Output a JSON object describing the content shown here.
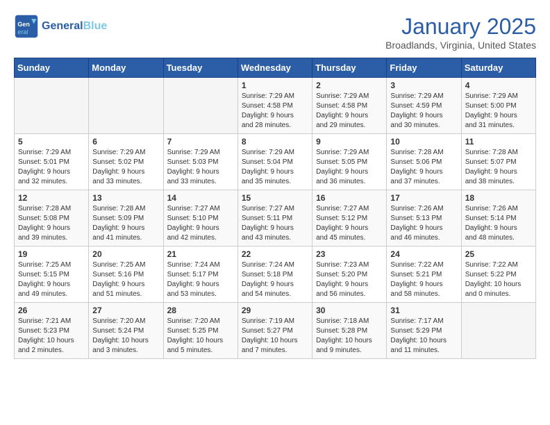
{
  "header": {
    "logo_general": "General",
    "logo_blue": "Blue",
    "month": "January 2025",
    "location": "Broadlands, Virginia, United States"
  },
  "days_of_week": [
    "Sunday",
    "Monday",
    "Tuesday",
    "Wednesday",
    "Thursday",
    "Friday",
    "Saturday"
  ],
  "weeks": [
    [
      {
        "day": "",
        "info": ""
      },
      {
        "day": "",
        "info": ""
      },
      {
        "day": "",
        "info": ""
      },
      {
        "day": "1",
        "info": "Sunrise: 7:29 AM\nSunset: 4:58 PM\nDaylight: 9 hours\nand 28 minutes."
      },
      {
        "day": "2",
        "info": "Sunrise: 7:29 AM\nSunset: 4:58 PM\nDaylight: 9 hours\nand 29 minutes."
      },
      {
        "day": "3",
        "info": "Sunrise: 7:29 AM\nSunset: 4:59 PM\nDaylight: 9 hours\nand 30 minutes."
      },
      {
        "day": "4",
        "info": "Sunrise: 7:29 AM\nSunset: 5:00 PM\nDaylight: 9 hours\nand 31 minutes."
      }
    ],
    [
      {
        "day": "5",
        "info": "Sunrise: 7:29 AM\nSunset: 5:01 PM\nDaylight: 9 hours\nand 32 minutes."
      },
      {
        "day": "6",
        "info": "Sunrise: 7:29 AM\nSunset: 5:02 PM\nDaylight: 9 hours\nand 33 minutes."
      },
      {
        "day": "7",
        "info": "Sunrise: 7:29 AM\nSunset: 5:03 PM\nDaylight: 9 hours\nand 33 minutes."
      },
      {
        "day": "8",
        "info": "Sunrise: 7:29 AM\nSunset: 5:04 PM\nDaylight: 9 hours\nand 35 minutes."
      },
      {
        "day": "9",
        "info": "Sunrise: 7:29 AM\nSunset: 5:05 PM\nDaylight: 9 hours\nand 36 minutes."
      },
      {
        "day": "10",
        "info": "Sunrise: 7:28 AM\nSunset: 5:06 PM\nDaylight: 9 hours\nand 37 minutes."
      },
      {
        "day": "11",
        "info": "Sunrise: 7:28 AM\nSunset: 5:07 PM\nDaylight: 9 hours\nand 38 minutes."
      }
    ],
    [
      {
        "day": "12",
        "info": "Sunrise: 7:28 AM\nSunset: 5:08 PM\nDaylight: 9 hours\nand 39 minutes."
      },
      {
        "day": "13",
        "info": "Sunrise: 7:28 AM\nSunset: 5:09 PM\nDaylight: 9 hours\nand 41 minutes."
      },
      {
        "day": "14",
        "info": "Sunrise: 7:27 AM\nSunset: 5:10 PM\nDaylight: 9 hours\nand 42 minutes."
      },
      {
        "day": "15",
        "info": "Sunrise: 7:27 AM\nSunset: 5:11 PM\nDaylight: 9 hours\nand 43 minutes."
      },
      {
        "day": "16",
        "info": "Sunrise: 7:27 AM\nSunset: 5:12 PM\nDaylight: 9 hours\nand 45 minutes."
      },
      {
        "day": "17",
        "info": "Sunrise: 7:26 AM\nSunset: 5:13 PM\nDaylight: 9 hours\nand 46 minutes."
      },
      {
        "day": "18",
        "info": "Sunrise: 7:26 AM\nSunset: 5:14 PM\nDaylight: 9 hours\nand 48 minutes."
      }
    ],
    [
      {
        "day": "19",
        "info": "Sunrise: 7:25 AM\nSunset: 5:15 PM\nDaylight: 9 hours\nand 49 minutes."
      },
      {
        "day": "20",
        "info": "Sunrise: 7:25 AM\nSunset: 5:16 PM\nDaylight: 9 hours\nand 51 minutes."
      },
      {
        "day": "21",
        "info": "Sunrise: 7:24 AM\nSunset: 5:17 PM\nDaylight: 9 hours\nand 53 minutes."
      },
      {
        "day": "22",
        "info": "Sunrise: 7:24 AM\nSunset: 5:18 PM\nDaylight: 9 hours\nand 54 minutes."
      },
      {
        "day": "23",
        "info": "Sunrise: 7:23 AM\nSunset: 5:20 PM\nDaylight: 9 hours\nand 56 minutes."
      },
      {
        "day": "24",
        "info": "Sunrise: 7:22 AM\nSunset: 5:21 PM\nDaylight: 9 hours\nand 58 minutes."
      },
      {
        "day": "25",
        "info": "Sunrise: 7:22 AM\nSunset: 5:22 PM\nDaylight: 10 hours\nand 0 minutes."
      }
    ],
    [
      {
        "day": "26",
        "info": "Sunrise: 7:21 AM\nSunset: 5:23 PM\nDaylight: 10 hours\nand 2 minutes."
      },
      {
        "day": "27",
        "info": "Sunrise: 7:20 AM\nSunset: 5:24 PM\nDaylight: 10 hours\nand 3 minutes."
      },
      {
        "day": "28",
        "info": "Sunrise: 7:20 AM\nSunset: 5:25 PM\nDaylight: 10 hours\nand 5 minutes."
      },
      {
        "day": "29",
        "info": "Sunrise: 7:19 AM\nSunset: 5:27 PM\nDaylight: 10 hours\nand 7 minutes."
      },
      {
        "day": "30",
        "info": "Sunrise: 7:18 AM\nSunset: 5:28 PM\nDaylight: 10 hours\nand 9 minutes."
      },
      {
        "day": "31",
        "info": "Sunrise: 7:17 AM\nSunset: 5:29 PM\nDaylight: 10 hours\nand 11 minutes."
      },
      {
        "day": "",
        "info": ""
      }
    ]
  ]
}
